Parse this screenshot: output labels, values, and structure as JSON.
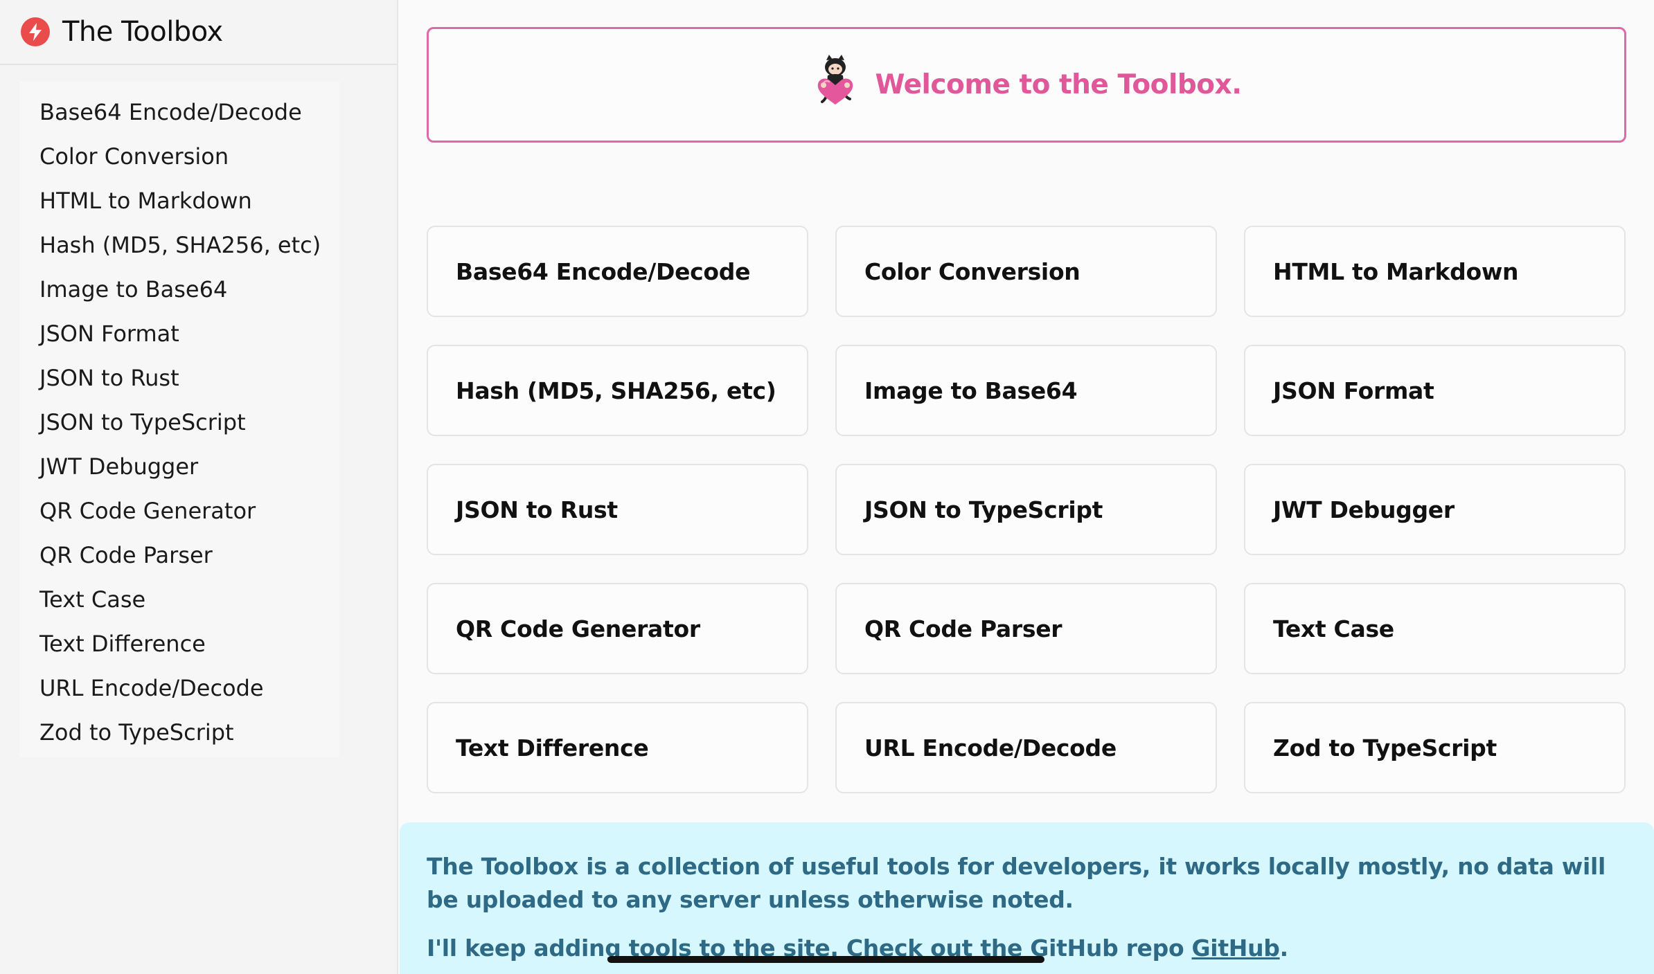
{
  "sidebar": {
    "brand_icon": "lightning-bolt-icon",
    "brand_color": "#ea4c4c",
    "title": "The Toolbox",
    "items": [
      {
        "label": "Base64 Encode/Decode"
      },
      {
        "label": "Color Conversion"
      },
      {
        "label": "HTML to Markdown"
      },
      {
        "label": "Hash (MD5, SHA256, etc)"
      },
      {
        "label": "Image to Base64"
      },
      {
        "label": "JSON Format"
      },
      {
        "label": "JSON to Rust"
      },
      {
        "label": "JSON to TypeScript"
      },
      {
        "label": "JWT Debugger"
      },
      {
        "label": "QR Code Generator"
      },
      {
        "label": "QR Code Parser"
      },
      {
        "label": "Text Case"
      },
      {
        "label": "Text Difference"
      },
      {
        "label": "URL Encode/Decode"
      },
      {
        "label": "Zod to TypeScript"
      }
    ]
  },
  "welcome": {
    "mascot_icon": "octocat-heart-icon",
    "text": "Welcome to the Toolbox.",
    "accent_color": "#e0579a"
  },
  "tools": [
    {
      "label": "Base64 Encode/Decode"
    },
    {
      "label": "Color Conversion"
    },
    {
      "label": "HTML to Markdown"
    },
    {
      "label": "Hash (MD5, SHA256, etc)"
    },
    {
      "label": "Image to Base64"
    },
    {
      "label": "JSON Format"
    },
    {
      "label": "JSON to Rust"
    },
    {
      "label": "JSON to TypeScript"
    },
    {
      "label": "JWT Debugger"
    },
    {
      "label": "QR Code Generator"
    },
    {
      "label": "QR Code Parser"
    },
    {
      "label": "Text Case"
    },
    {
      "label": "Text Difference"
    },
    {
      "label": "URL Encode/Decode"
    },
    {
      "label": "Zod to TypeScript"
    }
  ],
  "info": {
    "description": "The Toolbox is a collection of useful tools for developers, it works locally mostly, no data will be uploaded to any server unless otherwise noted.",
    "more_prefix": "I'll keep adding tools to the site. Check out the GitHub repo ",
    "github_link": "GitHub",
    "more_suffix": "."
  }
}
